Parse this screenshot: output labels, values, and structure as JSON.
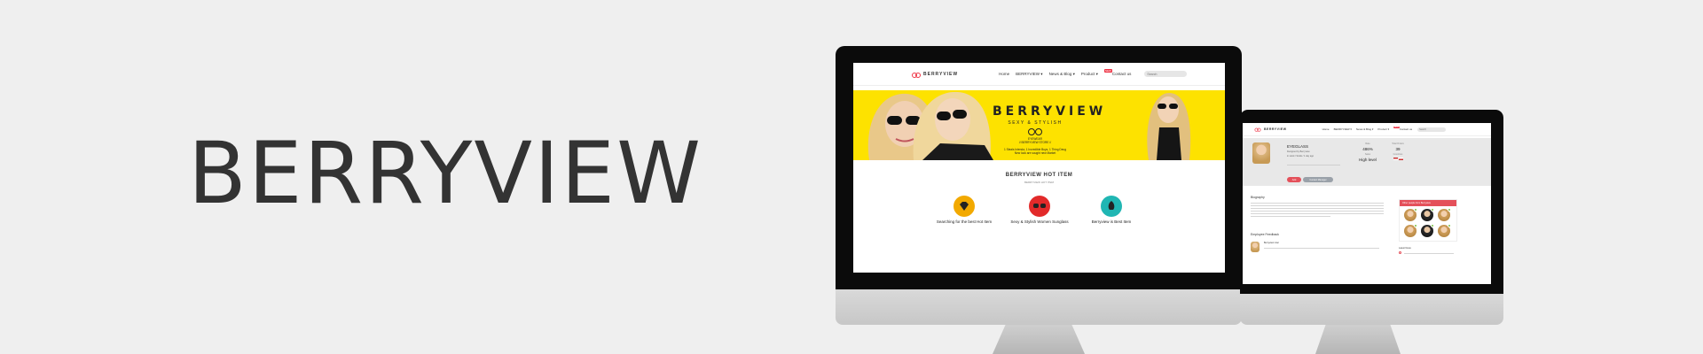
{
  "brand": {
    "title": "BERRYVIEW"
  },
  "desktop": {
    "logo": "BERRYVIEW",
    "nav": [
      "Home",
      "BERRYVIEW ▾",
      "News & Blog ▾",
      "Product ▾",
      "Contact us"
    ],
    "nav_badge": "NEW",
    "search_placeholder": "Search",
    "hero": {
      "title": "BERRYVIEW",
      "subtitle": "SEXY & STYLISH",
      "line1": "EYEWEAR",
      "line2": "// BERRYVIEW STORE //",
      "line3": "1 Steals Intenda, 1 Incredible Buys, 1 Thing Deug",
      "line4": "New look are sought new Market"
    },
    "hot_item": {
      "title": "BERRYVIEW HOT ITEM",
      "subtitle": "BERRYVIEW HOT ITEM"
    },
    "features": [
      {
        "label": "Searching for the best Hot Item",
        "icon": "diamond-icon",
        "color": "#f2a900"
      },
      {
        "label": "Sexy & Stylish Women Sunglass",
        "icon": "sunglasses-icon",
        "color": "#e22a2a"
      },
      {
        "label": "Berryview is Best Item",
        "icon": "rocket-icon",
        "color": "#20b6b3"
      }
    ]
  },
  "laptop": {
    "logo": "BERRYVIEW",
    "nav": [
      "Home",
      "BERRYVIEW ▾",
      "News & Blog ▾",
      "Product ▾",
      "Contact us"
    ],
    "nav_badge": "NEW",
    "search_placeholder": "Search",
    "profile": {
      "name": "EYEGLASS",
      "line1": "Designed by Berryview",
      "line2": "in stock / SALE / 1 day ago",
      "stats": [
        {
          "label": "Rate",
          "value": "486%",
          "sub": "Sales"
        },
        {
          "label": "Total Orders",
          "value": "39",
          "sub": "Countries"
        }
      ],
      "level": "High level",
      "btn_primary": "Add",
      "btn_secondary": "Contact Manager"
    },
    "sections": {
      "biography": "Biography",
      "feedback": "Employee Feedback",
      "feedback_name": "Berryview User",
      "sidebar_title": "Other people from Berryview",
      "latest_news": "Latest News"
    }
  }
}
